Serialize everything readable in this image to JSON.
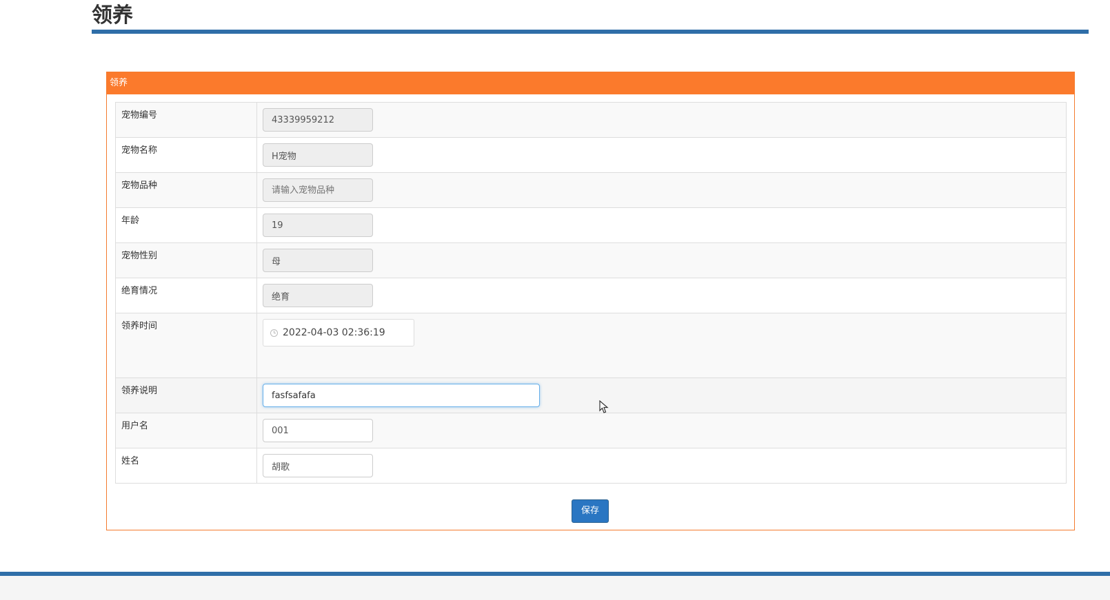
{
  "page": {
    "title": "领养"
  },
  "panel": {
    "heading": "领养",
    "fields": [
      {
        "label": "宠物编号",
        "value": "43339959212",
        "placeholder": "",
        "readonly": true
      },
      {
        "label": "宠物名称",
        "value": "H宠物",
        "placeholder": "",
        "readonly": true
      },
      {
        "label": "宠物品种",
        "value": "",
        "placeholder": "请输入宠物品种",
        "readonly": true
      },
      {
        "label": "年龄",
        "value": "19",
        "placeholder": "",
        "readonly": true
      },
      {
        "label": "宠物性别",
        "value": "母",
        "placeholder": "",
        "readonly": true
      },
      {
        "label": "绝育情况",
        "value": "绝育",
        "placeholder": "",
        "readonly": true
      },
      {
        "label": "领养时间",
        "value": "2022-04-03 02:36:19",
        "placeholder": "",
        "readonly": false
      },
      {
        "label": "领养说明",
        "value": "fasfsafafa",
        "placeholder": "",
        "readonly": false
      },
      {
        "label": "用户名",
        "value": "001",
        "placeholder": "",
        "readonly": false
      },
      {
        "label": "姓名",
        "value": "胡歌",
        "placeholder": "",
        "readonly": false
      }
    ],
    "save_label": "保存"
  },
  "colors": {
    "panel_heading": "#fb7a2c",
    "title_underline": "#2f6ea8",
    "primary_button": "#2a76c2"
  },
  "icons": {
    "date": "clock-icon",
    "pointer": "mouse-cursor-icon"
  }
}
